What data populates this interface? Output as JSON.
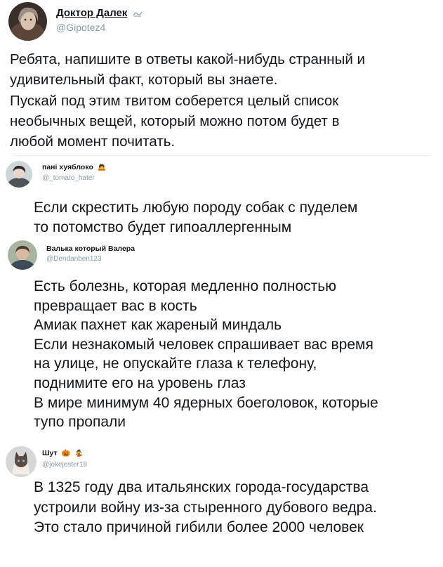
{
  "main_tweet": {
    "author_name": "Доктор Далек",
    "author_handle": "@Gipotez4",
    "text": "Ребята, напишите в ответы какой-нибудь странный и\nудивительный факт, который вы знаете.\nПускай под этим твитом соберется целый список\nнеобычных вещей, который можно потом будет в\nлюбой момент почитать."
  },
  "replies": [
    {
      "author_name": "пані хуяблоко",
      "author_handle": "@_tomato_hater",
      "badge_emoji": "🙇",
      "text": "Если скрестить любую породу собак с пуделем\nто потомство будет гипоаллергенным"
    },
    {
      "author_name": "Валька который Валера",
      "author_handle": "@Dendanben123",
      "text": "Есть болезнь, которая медленно полностью\nпревращает вас в кость\nАмиак пахнет как жареный миндаль\nЕсли незнакомый человек спрашивает вас время\nна улице, не опускайте глаза к телефону,\nподнимите его на уровень глаз\nВ мире минимум 40 ядерных боеголовок, которые\nтупо пропали"
    },
    {
      "author_name": "Шут",
      "author_handle": "@jokejester18",
      "badge_emojis": [
        "🎃",
        "🤹"
      ],
      "text": "В 1325 году два итальянских города-государства\nустроили войну из-за стыренного дубового ведра.\nЭто стало причиной гибили более 2000 человек"
    }
  ],
  "colors": {
    "text": "#14171a",
    "handle": "#8899a6",
    "divider": "#e6ecf0",
    "background": "#ffffff"
  },
  "icons": {
    "main_tweet_name_icon": "dalek-ornament-icon"
  }
}
